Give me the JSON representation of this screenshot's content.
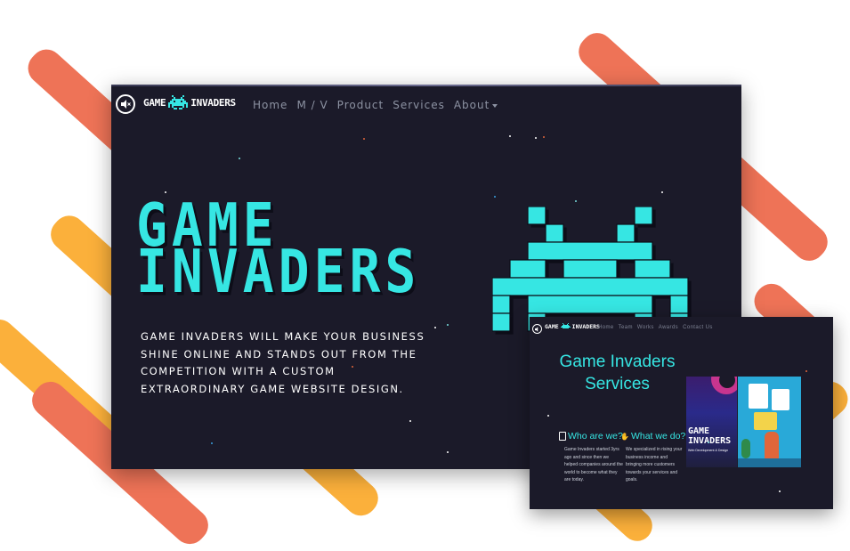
{
  "colors": {
    "accent": "#36e6e3",
    "background": "#1b1a29",
    "decor_orange": "#ee7357",
    "decor_yellow": "#fbb03b",
    "nav_text": "#8d93a3"
  },
  "main": {
    "logo": {
      "word1": "GAME",
      "word2": "INVADERS",
      "icon": "space-invader-icon"
    },
    "sound_icon": "speaker-mute-icon",
    "nav": [
      "Home",
      "M / V",
      "Product",
      "Services",
      "About"
    ],
    "hero": {
      "title_line1": "GAME",
      "title_line2": "INVADERS",
      "description": "GAME INVADERS WILL MAKE YOUR BUSINESS SHINE ONLINE AND STANDS OUT FROM THE COMPETITION WITH A CUSTOM EXTRAORDINARY GAME WEBSITE DESIGN.",
      "mascot_icon": "space-invader-icon"
    }
  },
  "secondary": {
    "logo": {
      "word1": "GAME",
      "word2": "INVADERS"
    },
    "nav": [
      "Home",
      "Team",
      "Works",
      "Awards",
      "Contact Us"
    ],
    "title_line1": "Game Invaders",
    "title_line2": "Services",
    "who": {
      "title": "Who are we?",
      "body": "Game Invaders started 3yrs ago and since then we helped companies around the world to become what they are today."
    },
    "what": {
      "title": "What we do?",
      "body": "We specialized in rising your business income and bringing more customers towards your services and goals."
    },
    "image_caption_title_line1": "GAME",
    "image_caption_title_line2": "INVADERS",
    "image_caption_sub": "Web Development & Design"
  }
}
